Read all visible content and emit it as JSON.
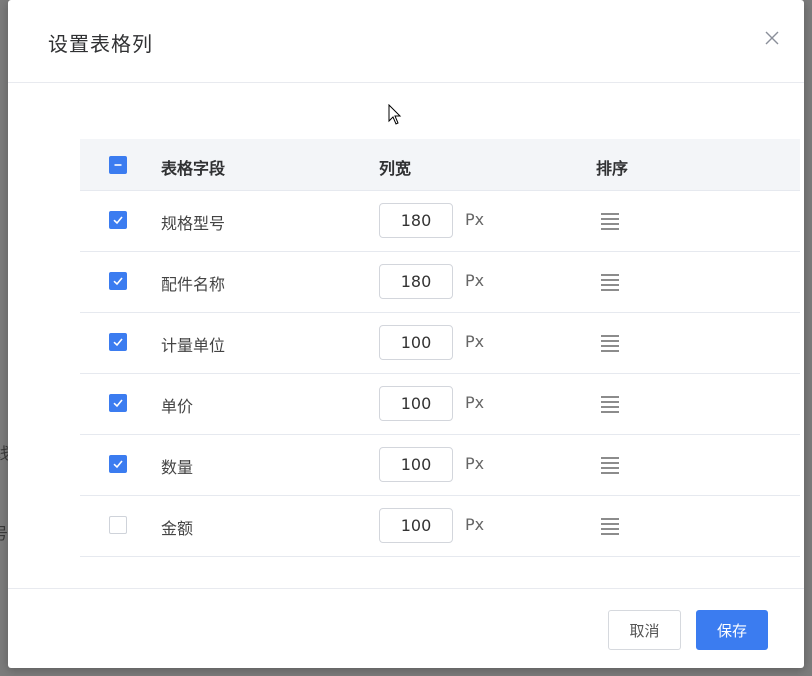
{
  "dialog": {
    "title": "设置表格列"
  },
  "table": {
    "headers": {
      "field": "表格字段",
      "width": "列宽",
      "sort": "排序"
    },
    "select_all_state": "indeterminate",
    "rows": [
      {
        "label": "规格型号",
        "width": "180",
        "unit": "Px",
        "checked": true
      },
      {
        "label": "配件名称",
        "width": "180",
        "unit": "Px",
        "checked": true
      },
      {
        "label": "计量单位",
        "width": "100",
        "unit": "Px",
        "checked": true
      },
      {
        "label": "单价",
        "width": "100",
        "unit": "Px",
        "checked": true
      },
      {
        "label": "数量",
        "width": "100",
        "unit": "Px",
        "checked": true
      },
      {
        "label": "金额",
        "width": "100",
        "unit": "Px",
        "checked": false
      }
    ]
  },
  "footer": {
    "cancel_label": "取消",
    "save_label": "保存"
  },
  "backdrop": {
    "fragment_1": "线",
    "fragment_2": "号"
  },
  "icons": {
    "close": "close-icon",
    "drag": "drag-handle-icon",
    "check": "check-icon",
    "indeterminate": "minus-icon",
    "cursor": "mouse-cursor-icon"
  },
  "colors": {
    "accent": "#3b7cf0",
    "header_bg": "#f3f5f8"
  }
}
